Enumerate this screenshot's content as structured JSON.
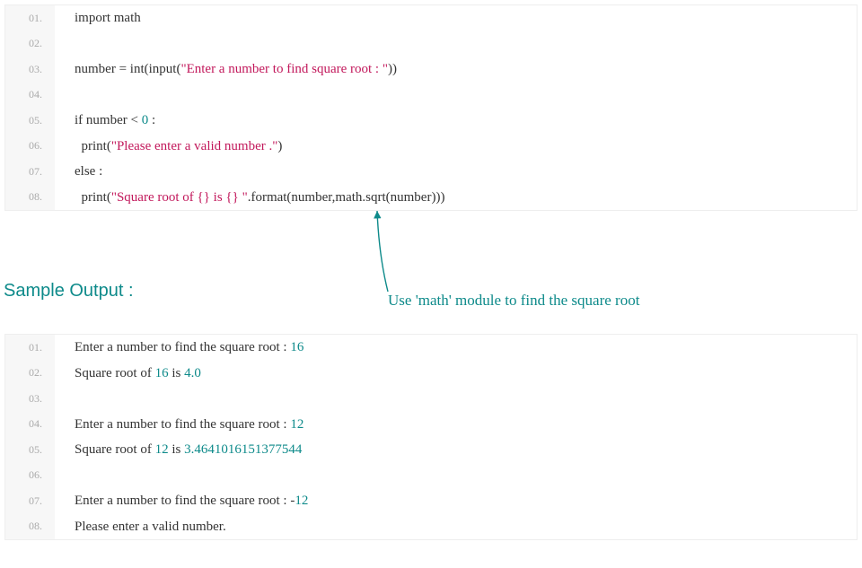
{
  "codeBlock": {
    "lines": [
      {
        "no": "01.",
        "tokens": [
          {
            "text": "import math",
            "cls": "tok-plain"
          }
        ]
      },
      {
        "no": "02.",
        "tokens": []
      },
      {
        "no": "03.",
        "tokens": [
          {
            "text": "number = int(input(",
            "cls": "tok-plain"
          },
          {
            "text": "\"Enter a number to find square root : \"",
            "cls": "tok-str"
          },
          {
            "text": "))",
            "cls": "tok-plain"
          }
        ]
      },
      {
        "no": "04.",
        "tokens": []
      },
      {
        "no": "05.",
        "tokens": [
          {
            "text": "if number < ",
            "cls": "tok-plain"
          },
          {
            "text": "0",
            "cls": "tok-num"
          },
          {
            "text": " :",
            "cls": "tok-plain"
          }
        ]
      },
      {
        "no": "06.",
        "tokens": [
          {
            "text": "  print(",
            "cls": "tok-plain"
          },
          {
            "text": "\"Please enter a valid number .\"",
            "cls": "tok-str"
          },
          {
            "text": ")",
            "cls": "tok-plain"
          }
        ]
      },
      {
        "no": "07.",
        "tokens": [
          {
            "text": "else :",
            "cls": "tok-plain"
          }
        ]
      },
      {
        "no": "08.",
        "tokens": [
          {
            "text": "  print(",
            "cls": "tok-plain"
          },
          {
            "text": "\"Square root of {} is {} \"",
            "cls": "tok-str"
          },
          {
            "text": ".format(number,math.sqrt(number)))",
            "cls": "tok-plain"
          }
        ]
      }
    ]
  },
  "sectionHeading": "Sample Output :",
  "annotation": "Use 'math' module to find the square root",
  "outputBlock": {
    "lines": [
      {
        "no": "01.",
        "tokens": [
          {
            "text": "Enter a number to find the square root : ",
            "cls": "tok-plain"
          },
          {
            "text": "16",
            "cls": "tok-num"
          }
        ]
      },
      {
        "no": "02.",
        "tokens": [
          {
            "text": "Square root of ",
            "cls": "tok-plain"
          },
          {
            "text": "16",
            "cls": "tok-num"
          },
          {
            "text": " is ",
            "cls": "tok-plain"
          },
          {
            "text": "4.0",
            "cls": "tok-num"
          }
        ]
      },
      {
        "no": "03.",
        "tokens": []
      },
      {
        "no": "04.",
        "tokens": [
          {
            "text": "Enter a number to find the square root : ",
            "cls": "tok-plain"
          },
          {
            "text": "12",
            "cls": "tok-num"
          }
        ]
      },
      {
        "no": "05.",
        "tokens": [
          {
            "text": "Square root of ",
            "cls": "tok-plain"
          },
          {
            "text": "12",
            "cls": "tok-num"
          },
          {
            "text": " is ",
            "cls": "tok-plain"
          },
          {
            "text": "3.4641016151377544",
            "cls": "tok-num"
          }
        ]
      },
      {
        "no": "06.",
        "tokens": []
      },
      {
        "no": "07.",
        "tokens": [
          {
            "text": "Enter a number to find the square root : -",
            "cls": "tok-plain"
          },
          {
            "text": "12",
            "cls": "tok-num"
          }
        ]
      },
      {
        "no": "08.",
        "tokens": [
          {
            "text": "Please enter a valid number.",
            "cls": "tok-plain"
          }
        ]
      }
    ]
  }
}
